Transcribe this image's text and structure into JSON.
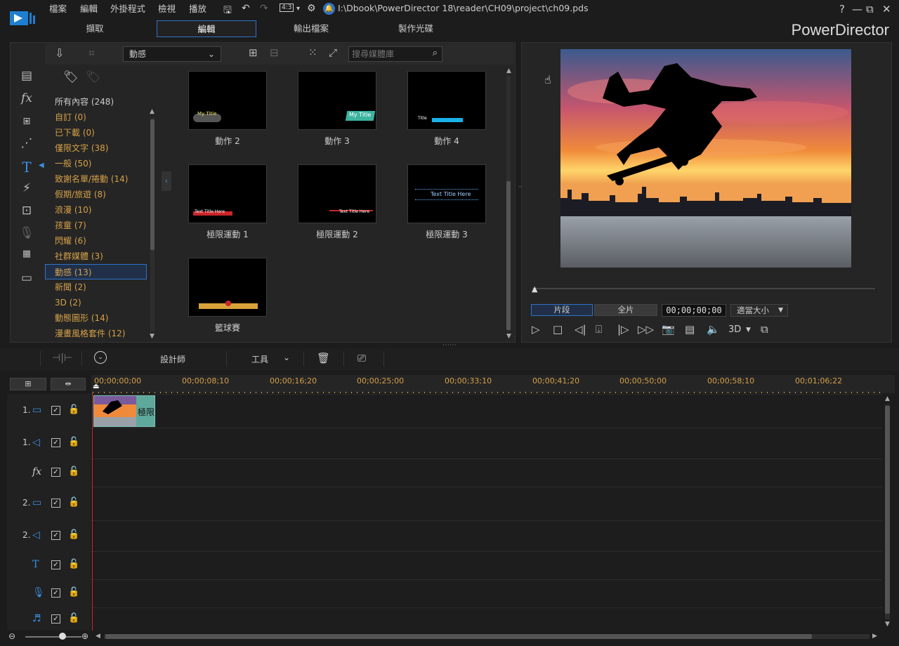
{
  "menu": {
    "items": [
      "檔案",
      "編輯",
      "外掛程式",
      "檢視",
      "播放"
    ],
    "ratio": "4:3",
    "path": "I:\\Dbook\\PowerDirector 18\\reader\\CH09\\project\\ch09.pds"
  },
  "window": {
    "help": "?",
    "minimize": "—",
    "restore": "⧉",
    "close": "✕"
  },
  "tabs": [
    "擷取",
    "編輯",
    "輸出檔案",
    "製作光碟"
  ],
  "brand": "PowerDirector",
  "library": {
    "dropdown": "動感",
    "search_placeholder": "搜尋媒體庫",
    "categories": [
      "所有內容 (248)",
      "自訂  (0)",
      "已下載  (0)",
      "僅限文字  (38)",
      "一般  (50)",
      "致謝名單/捲動  (14)",
      "假期/旅遊  (8)",
      "浪漫  (10)",
      "孩童  (7)",
      "閃耀  (6)",
      "社群媒體  (3)",
      "動感  (13)",
      "新聞  (2)",
      "3D  (2)",
      "動態圖形  (14)",
      "漫畫風格套件  (12)"
    ],
    "thumbs": [
      {
        "label": "動作 2",
        "caption": "My Title"
      },
      {
        "label": "動作 3",
        "caption": "My Title"
      },
      {
        "label": "動作 4",
        "caption": "Title"
      },
      {
        "label": "極限運動 1",
        "caption": "Text Title Here"
      },
      {
        "label": "極限運動 2",
        "caption": "Text Title Here"
      },
      {
        "label": "極限運動 3",
        "caption": "Text Title Here"
      },
      {
        "label": "籃球賽",
        "caption": ""
      }
    ]
  },
  "preview": {
    "clip_btn": "片段",
    "movie_btn": "全片",
    "timecode": "00;00;00;00",
    "fit": "適當大小",
    "mode_3d": "3D"
  },
  "toolbar": {
    "designer": "設計師",
    "tools": "工具"
  },
  "timeline": {
    "ticks": [
      "00;00;00;00",
      "00;00;08;10",
      "00;00;16;20",
      "00;00;25;00",
      "00;00;33;10",
      "00;00;41;20",
      "00;00;50;00",
      "00;00;58;10",
      "00;01;06;22"
    ],
    "tracks": [
      {
        "num": "1.",
        "icon": "video-track-icon",
        "glyph": "▭"
      },
      {
        "num": "1.",
        "icon": "audio-track-icon",
        "glyph": "◁"
      },
      {
        "num": "",
        "icon": "fx-track-icon",
        "glyph": "fx"
      },
      {
        "num": "2.",
        "icon": "video-track-icon",
        "glyph": "▭"
      },
      {
        "num": "2.",
        "icon": "audio-track-icon",
        "glyph": "◁"
      },
      {
        "num": "",
        "icon": "title-track-icon",
        "glyph": "T"
      },
      {
        "num": "",
        "icon": "voice-track-icon",
        "glyph": "🎙"
      },
      {
        "num": "",
        "icon": "music-track-icon",
        "glyph": "♬"
      }
    ],
    "clip_label": "極限"
  }
}
